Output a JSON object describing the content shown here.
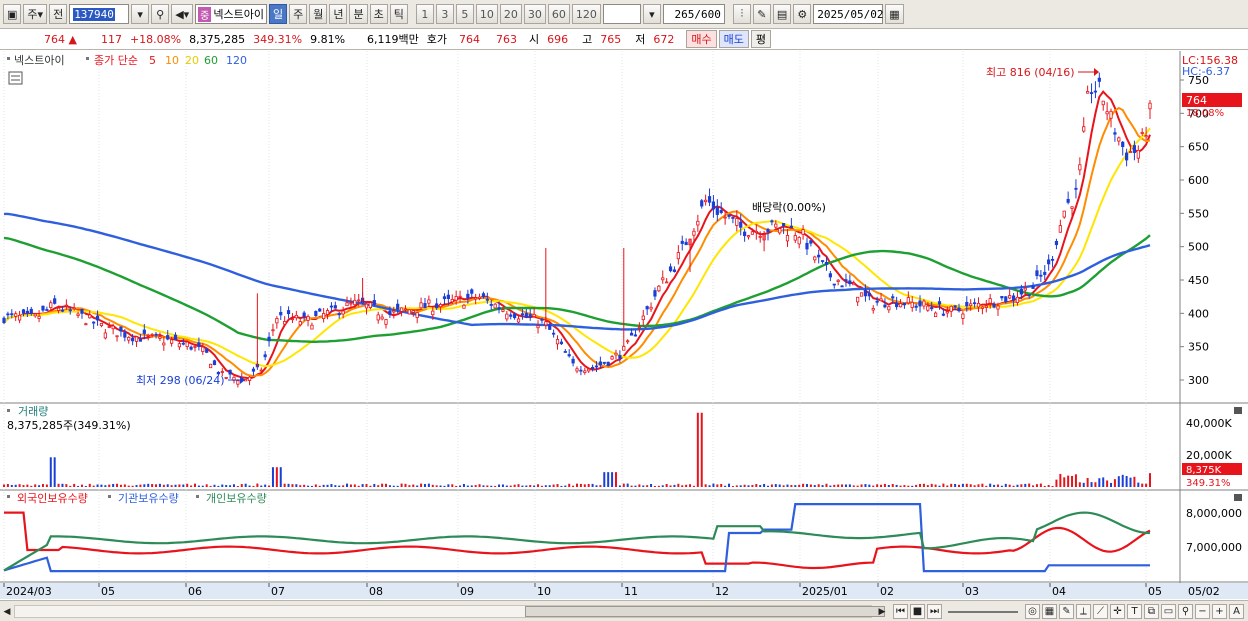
{
  "toolbar": {
    "period_main": "주",
    "period_prev": "전",
    "code": "137940",
    "name_badge": "중",
    "name": "넥스트아이",
    "periods": [
      "일",
      "주",
      "월",
      "년",
      "분",
      "초",
      "틱"
    ],
    "active_period": "일",
    "intervals": [
      "1",
      "3",
      "5",
      "10",
      "20",
      "30",
      "60",
      "120"
    ],
    "count": "265",
    "count_total": "/600",
    "date": "2025/05/02"
  },
  "quote": {
    "price": "764",
    "change": "117",
    "change_pct": "+18.08%",
    "volume": "8,375,285",
    "volume_ratio": "349.31%",
    "turnover": "9.81%",
    "amount": "6,119백만",
    "bid_label": "호가",
    "ask": "764",
    "bid": "763",
    "open_label": "시",
    "open": "696",
    "high_label": "고",
    "high": "765",
    "low_label": "저",
    "low": "672",
    "buy_label": "매수",
    "sell_label": "매도",
    "eval_label": "평"
  },
  "price_panel": {
    "name": "넥스트아이",
    "legend_label": "종가 단순",
    "ma": [
      {
        "period": "5",
        "color": "#e8141c"
      },
      {
        "period": "10",
        "color": "#ff8c00"
      },
      {
        "period": "20",
        "color": "#ffe600"
      },
      {
        "period": "60",
        "color": "#1e9f32"
      },
      {
        "period": "120",
        "color": "#2e5fdc"
      }
    ],
    "lc": "LC:156.38",
    "hc": "HC:-6.37",
    "current_price": "764",
    "current_pct": "18.08%",
    "high_note": "최고 816 (04/16)",
    "low_note": "최저 298 (06/24)",
    "dividend_note": "배당락(0.00%)",
    "y_ticks": [
      "750",
      "700",
      "650",
      "600",
      "550",
      "500",
      "450",
      "400",
      "350",
      "300"
    ]
  },
  "volume_panel": {
    "title": "거래량",
    "value": "8,375,285주(349.31%)",
    "y_ticks": [
      "40,000K",
      "20,000K"
    ],
    "current_value": "8,375K",
    "current_pct": "349.31%"
  },
  "holding_panel": {
    "series": [
      {
        "name": "외국인보유수량",
        "color": "#e8141c"
      },
      {
        "name": "기관보유수량",
        "color": "#2e5fdc"
      },
      {
        "name": "개인보유수량",
        "color": "#2e8b57"
      }
    ],
    "y_ticks": [
      "8,000,000",
      "7,000,000"
    ]
  },
  "x_axis": [
    "2024/03",
    "05",
    "06",
    "07",
    "08",
    "09",
    "10",
    "11",
    "12",
    "2025/01",
    "02",
    "03",
    "04",
    "05"
  ],
  "x_axis_right": "05/02",
  "colors": {
    "up": "#e8141c",
    "down": "#1a3fd6",
    "price_tag": "#e8141c"
  }
}
